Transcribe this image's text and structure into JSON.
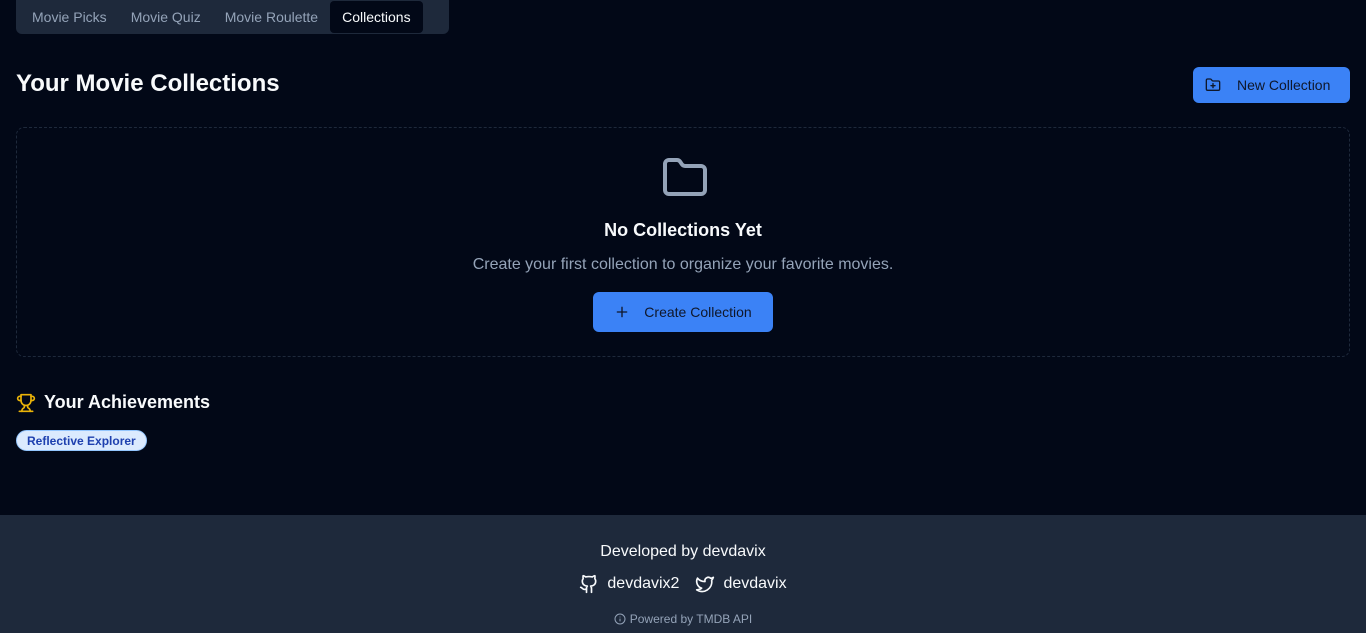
{
  "tabs": [
    {
      "label": "Movie Picks",
      "active": false
    },
    {
      "label": "Movie Quiz",
      "active": false
    },
    {
      "label": "Movie Roulette",
      "active": false
    },
    {
      "label": "Collections",
      "active": true
    }
  ],
  "header": {
    "title": "Your Movie Collections",
    "new_collection_label": "New Collection"
  },
  "empty_state": {
    "title": "No Collections Yet",
    "description": "Create your first collection to organize your favorite movies.",
    "create_label": "Create Collection"
  },
  "achievements": {
    "title": "Your Achievements",
    "badges": [
      "Reflective Explorer"
    ]
  },
  "footer": {
    "developed_by": "Developed by devdavix",
    "github": "devdavix2",
    "twitter": "devdavix",
    "powered_by": "Powered by TMDB API"
  },
  "icons": {
    "new_collection": "folder-plus-icon",
    "empty_state": "folder-icon",
    "create": "plus-icon",
    "achievements": "trophy-icon",
    "github": "github-icon",
    "twitter": "twitter-icon",
    "info": "info-icon"
  },
  "colors": {
    "background": "#020817",
    "accent": "#3b82f6",
    "trophy": "#eab308",
    "footer_bg": "#1e293b"
  }
}
